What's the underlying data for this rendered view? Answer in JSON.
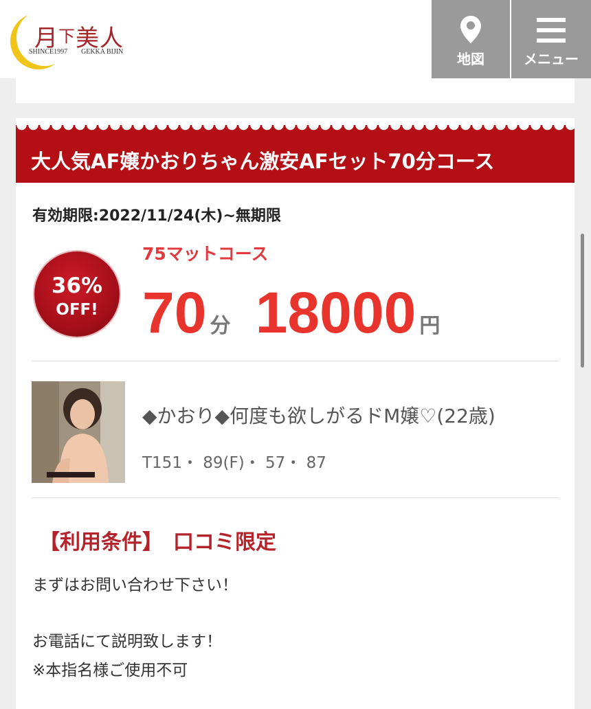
{
  "header": {
    "logo": {
      "title_main": "月",
      "title_small": "下",
      "title_rest": "美人",
      "since": "SHINCE1997",
      "roman": "GEKKA BIJIN"
    },
    "nav": {
      "map_label": "地図",
      "menu_label": "メニュー",
      "map_icon": "map-pin-icon",
      "menu_icon": "hamburger-menu-icon"
    }
  },
  "coupon": {
    "title": "大人気AF嬢かおりちゃん激安AFセット70分コース",
    "validity": "有効期限:2022/11/24(木)~無期限",
    "badge": {
      "percent": "36%",
      "off": "OFF!"
    },
    "course_name": "75マットコース",
    "minutes": "70",
    "minutes_unit": "分",
    "price": "18000",
    "price_unit": "円",
    "cast": {
      "name": "◆かおり◆何度も欲しがるドM嬢♡(22歳)",
      "size": "T151・ 89(F)・ 57・ 87"
    },
    "conditions": {
      "title": "【利用条件】　口コミ限定",
      "lines": [
        "まずはお問い合わせ下さい！",
        "お電話にて説明致します！",
        "※本指名様ご使用不可"
      ]
    }
  },
  "colors": {
    "accent_red": "#b40f15",
    "price_red": "#e8342d",
    "nav_gray": "#9a9a9a",
    "logo_gold": "#f0c419"
  }
}
